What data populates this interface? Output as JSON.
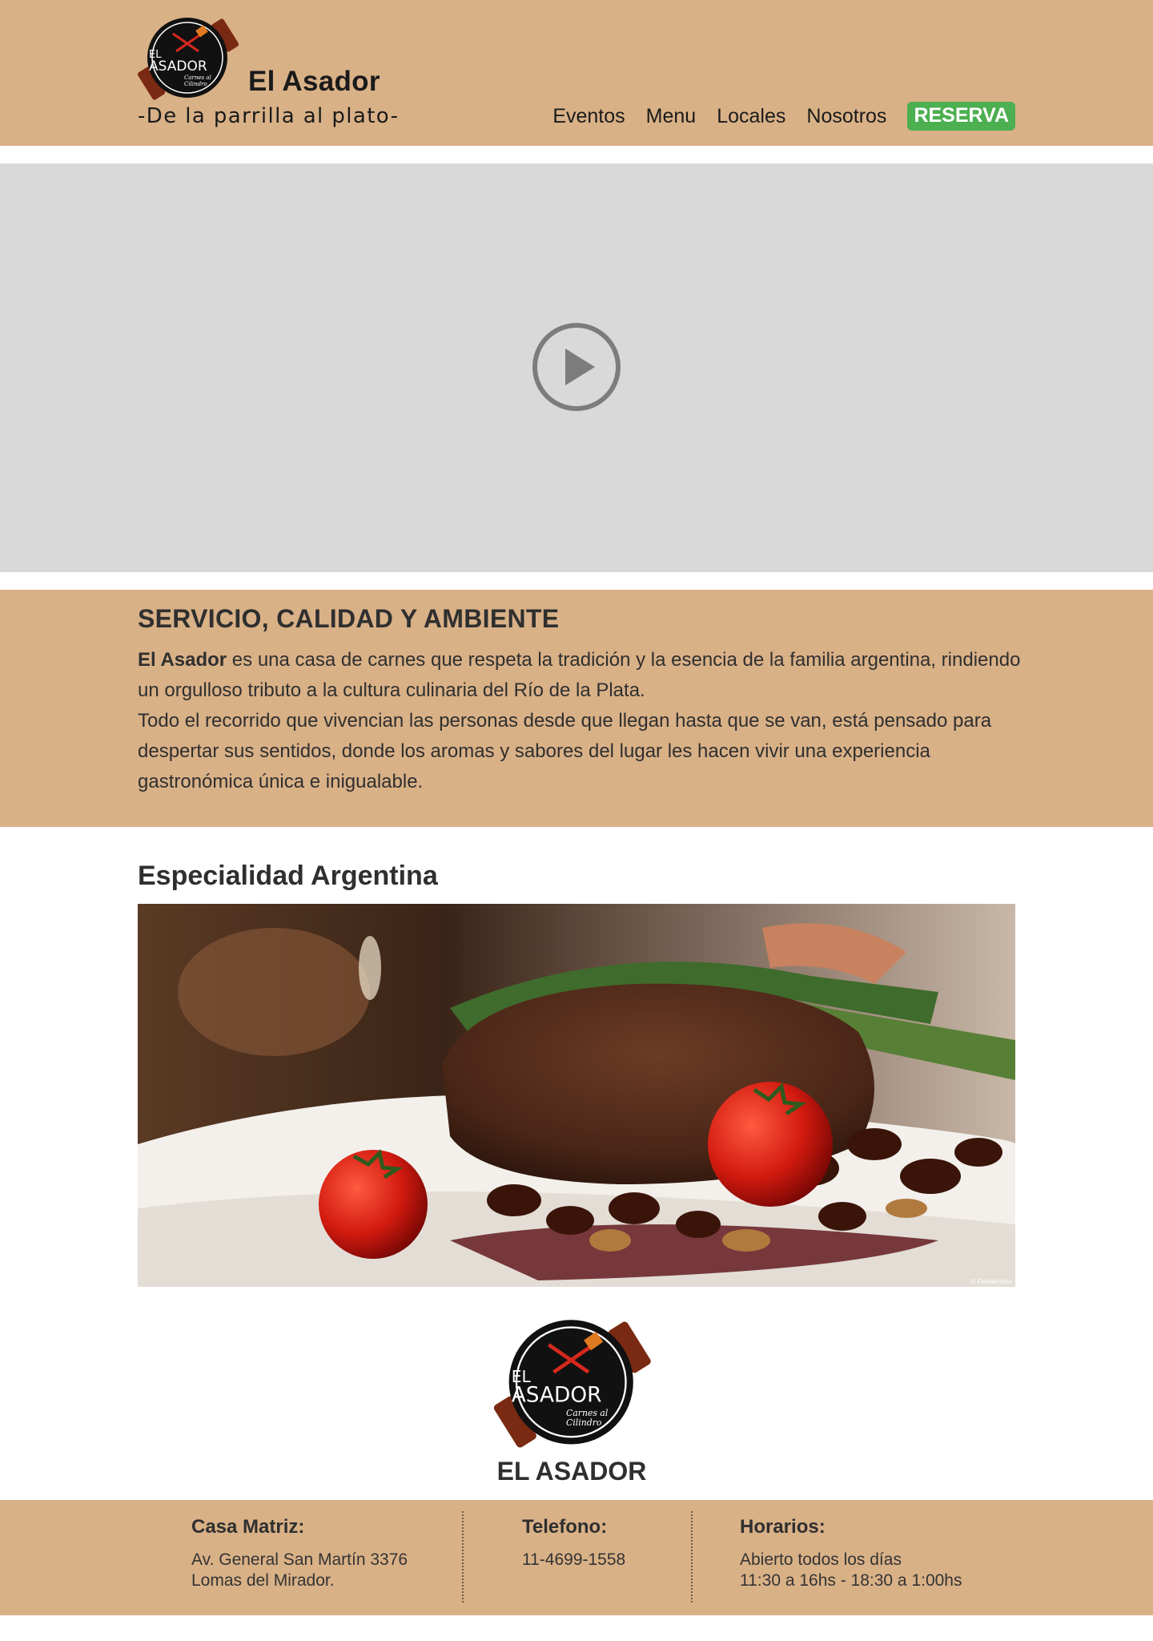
{
  "header": {
    "brand": "El Asador",
    "tagline": "-De la parrilla al plato-",
    "nav": [
      "Eventos",
      "Menu",
      "Locales",
      "Nosotros"
    ],
    "reserve_label": "RESERVA"
  },
  "logo": {
    "line1": "EL",
    "line2": "ASADOR",
    "line3": "Carnes al",
    "line4": "Cilindro"
  },
  "about": {
    "title": "SERVICIO, CALIDAD Y AMBIENTE",
    "brand_bold": "El Asador",
    "text_part1": " es una casa de carnes que respeta la tradición y la esencia de la familia argentina, rindiendo un orgulloso tributo a la cultura culinaria del Río de la Plata.",
    "text_part2": "Todo el recorrido que vivencian las personas desde que llegan hasta que se van, está pensado para despertar sus sentidos, donde los aromas y sabores del lugar les hacen vivir una experiencia gastronómica única e inigualable."
  },
  "specialty": {
    "title": "Especialidad Argentina",
    "image_credit": "© Fotolia/Vitss"
  },
  "footer": {
    "name": "EL ASADOR",
    "address_title": "Casa Matriz:",
    "address_line1": "Av. General San Martín 3376",
    "address_line2": "Lomas del Mirador.",
    "phone_title": "Telefono:",
    "phone": "11-4699-1558",
    "hours_title": "Horarios:",
    "hours_line1": "Abierto todos los días",
    "hours_line2": "11:30 a 16hs - 18:30 a 1:00hs"
  },
  "colors": {
    "band": "#d9b187",
    "reserve": "#4caf50",
    "video_bg": "#d9d9d9"
  }
}
